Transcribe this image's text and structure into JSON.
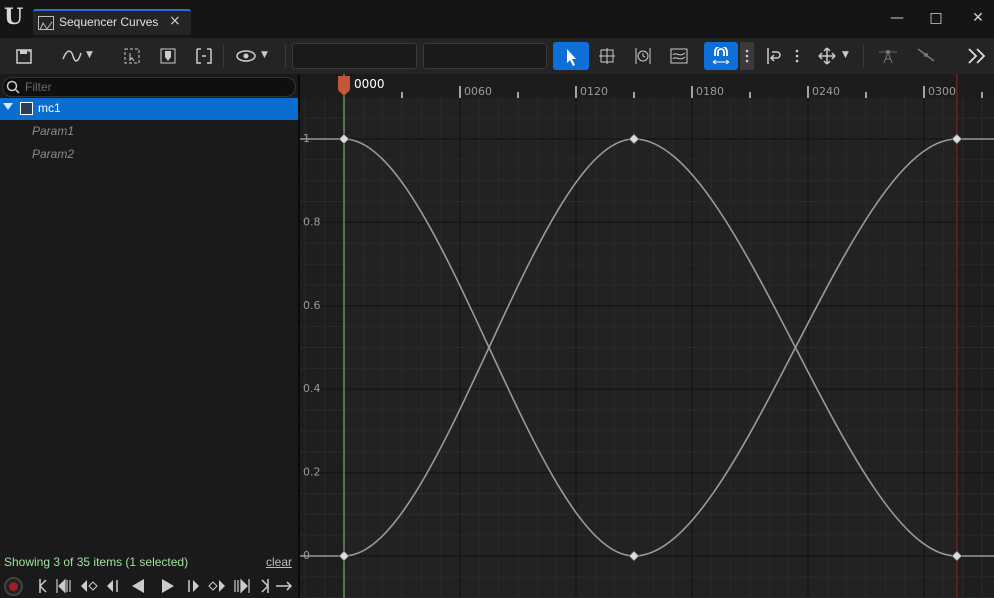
{
  "window": {
    "tab_title": "Sequencer Curves",
    "tab_close": "×",
    "minimize": "—",
    "maximize": "□",
    "close": "✕"
  },
  "toolbar": {
    "field_1": "",
    "field_2": ""
  },
  "tree": {
    "filter_placeholder": "Filter",
    "root": {
      "label": "mc1",
      "expanded": true,
      "selected": true
    },
    "children": [
      {
        "label": "Param1"
      },
      {
        "label": "Param2"
      }
    ],
    "status": "Showing 3 of 35 items (1 selected)",
    "clear": "clear"
  },
  "timeline": {
    "playhead_label": "0000",
    "ticks": [
      {
        "frame": 60,
        "label": "0060"
      },
      {
        "frame": 120,
        "label": "0120"
      },
      {
        "frame": 180,
        "label": "0180"
      },
      {
        "frame": 240,
        "label": "0240"
      },
      {
        "frame": 300,
        "label": "0300"
      }
    ],
    "playhead_frame": 0,
    "end_frame": 317,
    "value_ticks": [
      {
        "value": 1,
        "label": "1"
      },
      {
        "value": 0.8,
        "label": "0.8"
      },
      {
        "value": 0.6,
        "label": "0.6"
      },
      {
        "value": 0.4,
        "label": "0.4"
      },
      {
        "value": 0.2,
        "label": "0.2"
      },
      {
        "value": 0,
        "label": "0"
      }
    ]
  },
  "chart_data": {
    "type": "line",
    "xlabel": "",
    "ylabel": "",
    "xlim": [
      -22,
      338
    ],
    "ylim": [
      -0.1,
      1.1
    ],
    "series": [
      {
        "name": "Param1",
        "x": [
          0,
          150,
          317
        ],
        "values": [
          1,
          0,
          1
        ],
        "color": "#9a9a9a"
      },
      {
        "name": "Param2",
        "x": [
          0,
          150,
          317
        ],
        "values": [
          0,
          1,
          0
        ],
        "color": "#9a9a9a"
      }
    ]
  },
  "colors": {
    "accent": "#0a6ed1",
    "playhead": "#c2553a",
    "start_marker": "#8ad08a",
    "end_marker": "#8a2a2a"
  }
}
